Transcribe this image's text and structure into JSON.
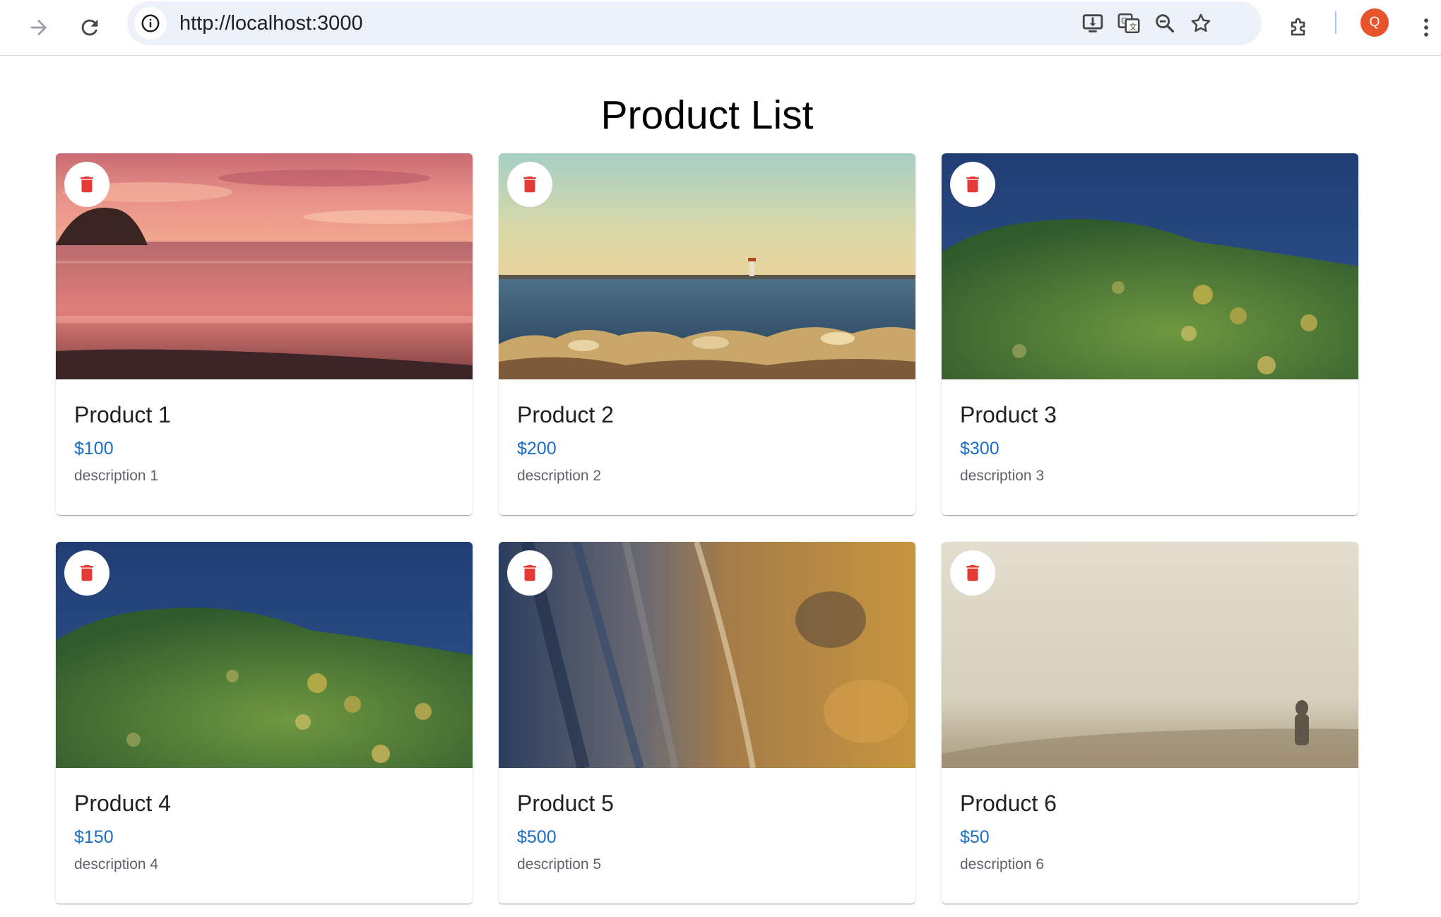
{
  "browser": {
    "url": "http://localhost:3000",
    "profile_initial": "Q",
    "accent_color": "#e8532c",
    "icons": [
      "forward-icon",
      "reload-icon",
      "site-info-icon",
      "install-app-icon",
      "translate-icon",
      "zoom-out-icon",
      "bookmark-star-icon",
      "extensions-icon",
      "menu-kebab-icon"
    ]
  },
  "page": {
    "title": "Product List"
  },
  "colors": {
    "price": "#1a6fc9",
    "delete_icon": "#e53935"
  },
  "products": [
    {
      "name": "Product 1",
      "price": "$100",
      "description": "description 1",
      "image": "sunset-beach"
    },
    {
      "name": "Product 2",
      "price": "$200",
      "description": "description 2",
      "image": "lighthouse-shore"
    },
    {
      "name": "Product 3",
      "price": "$300",
      "description": "description 3",
      "image": "green-hill"
    },
    {
      "name": "Product 4",
      "price": "$150",
      "description": "description 4",
      "image": "green-hill"
    },
    {
      "name": "Product 5",
      "price": "$500",
      "description": "description 5",
      "image": "aerial-terrain"
    },
    {
      "name": "Product 6",
      "price": "$50",
      "description": "description 6",
      "image": "foggy-field"
    }
  ]
}
